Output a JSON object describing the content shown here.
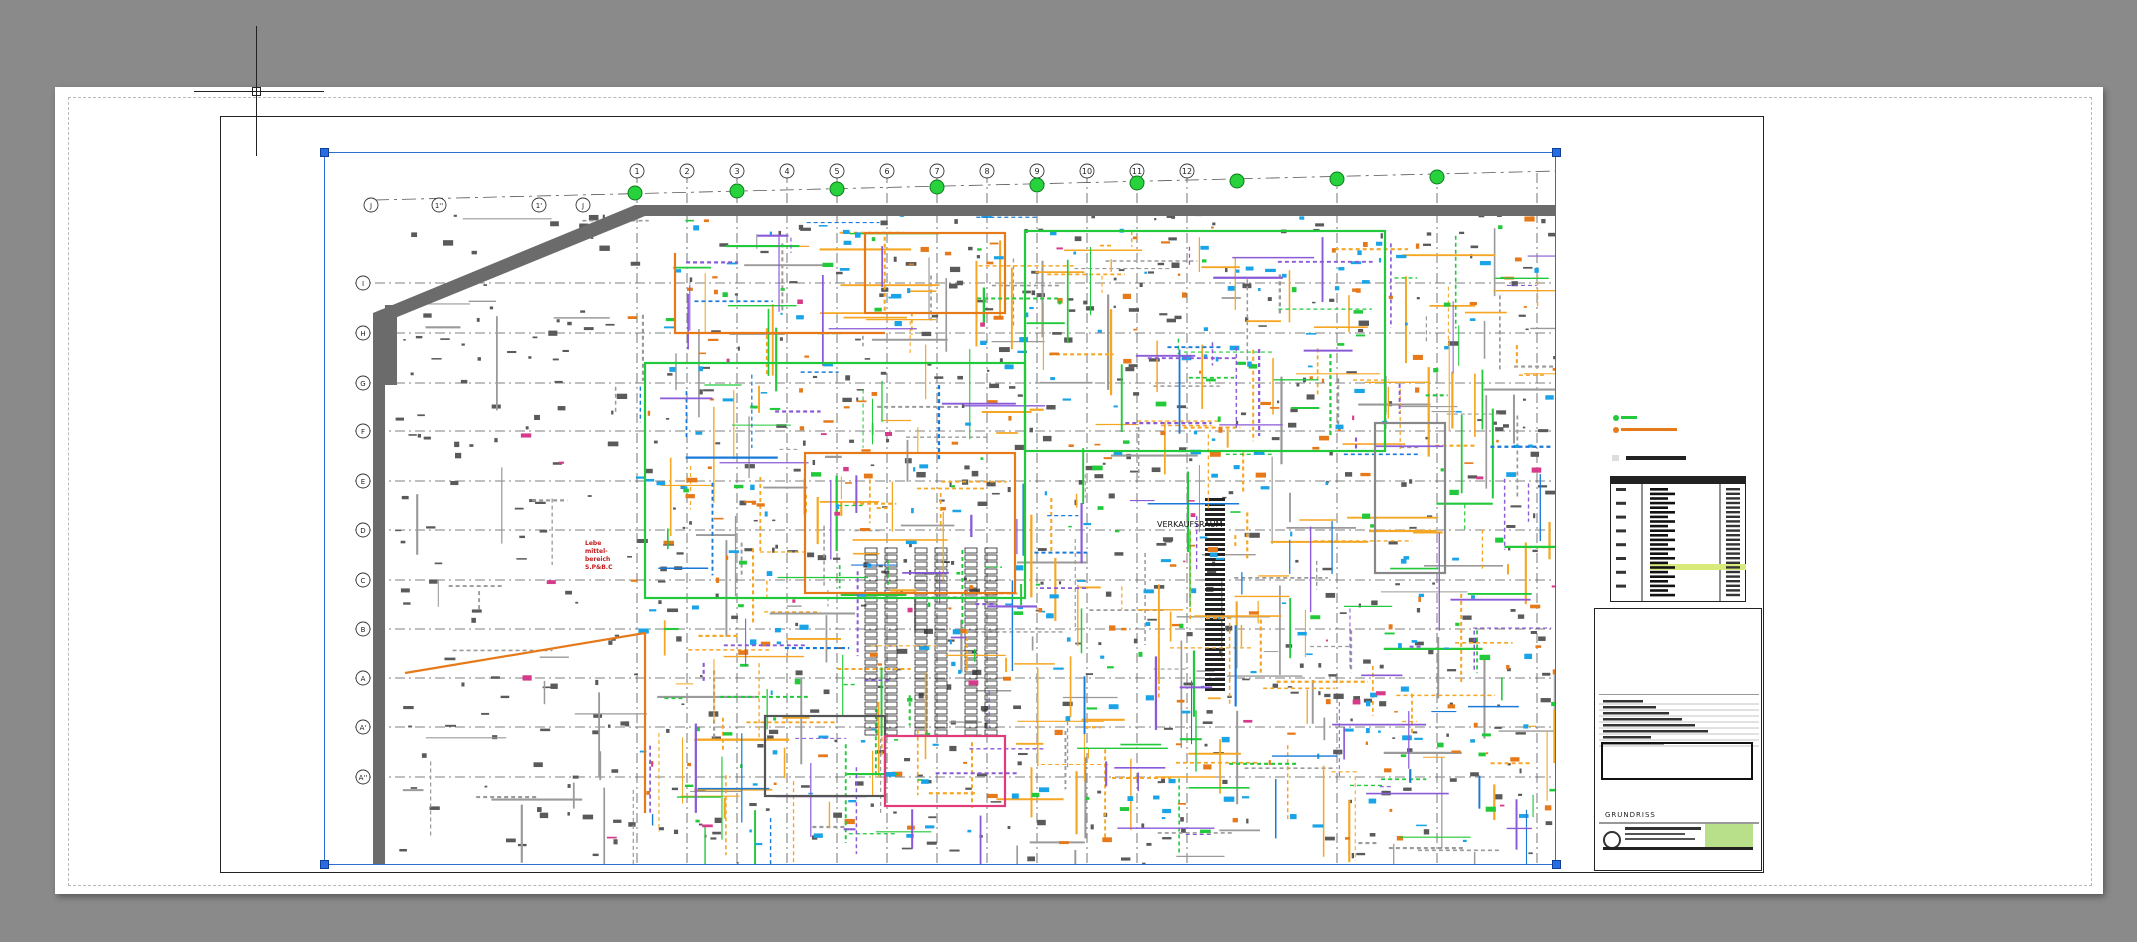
{
  "colors": {
    "canvas_background": "#8a8a8a",
    "paper": "#ffffff",
    "viewport_border": "#2f6fd1",
    "wall": "#6b6b6b",
    "pipe_green": "#22c93a",
    "pipe_orange": "#f5a623",
    "pipe_red": "#e23b1a",
    "duct_blue": "#1aa3e6",
    "duct_purple": "#8a5ad8",
    "note_red": "#c21a1a"
  },
  "drawing": {
    "column_grid_labels": [
      "1",
      "2",
      "3",
      "4",
      "5",
      "6",
      "7",
      "8",
      "9",
      "10",
      "11",
      "12"
    ],
    "row_grid_labels": [
      "I",
      "H",
      "G",
      "F",
      "E",
      "D",
      "C",
      "B",
      "A",
      "A'",
      "A''"
    ],
    "corner_grid_labels": [
      "J",
      "1''",
      "1'",
      "J"
    ],
    "area_label": "VERKAUFSRAUM",
    "red_note_lines": [
      "Lebe",
      "mittel-",
      "bereich",
      "S.P&B.C"
    ]
  },
  "title_block": {
    "drawing_label": "GRUNDRISS"
  },
  "icons": {
    "crosshair": "crosshair-cursor-icon",
    "grip": "viewport-grip-icon"
  }
}
